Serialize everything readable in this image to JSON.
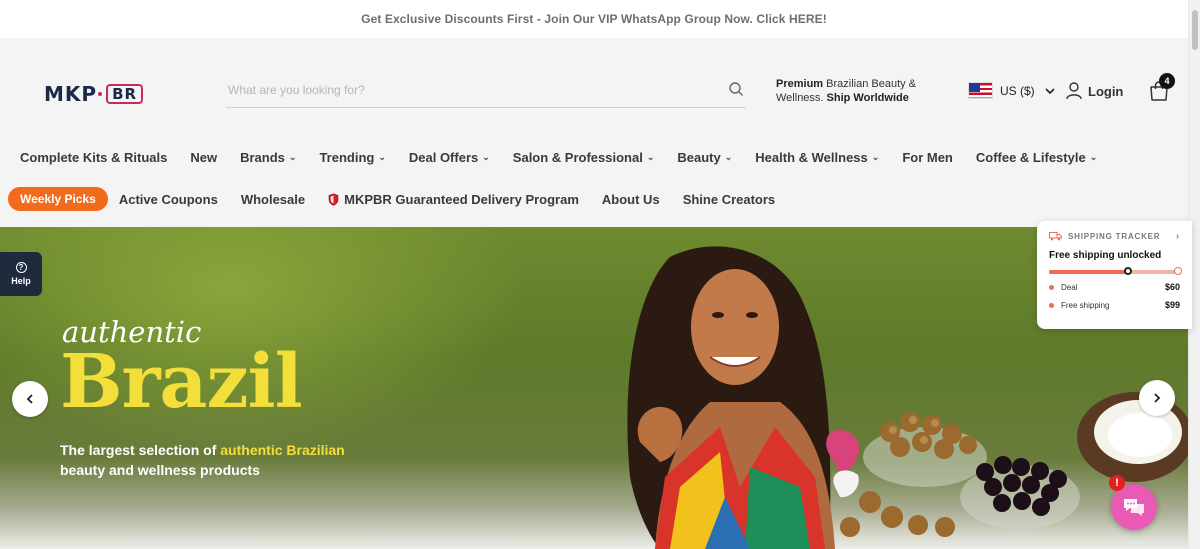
{
  "announcement": {
    "text": "Get Exclusive Discounts First - Join Our VIP WhatsApp Group Now. Click HERE!"
  },
  "header": {
    "logo_main": "MKP",
    "logo_suffix": "BR",
    "search": {
      "placeholder": "What are you looking for?"
    },
    "promo": {
      "bold_1": "Premium",
      "text_1": " Brazilian Beauty & Wellness.",
      "bold_2": " Ship Worldwide"
    },
    "currency": {
      "label": "US ($)"
    },
    "login_label": "Login",
    "cart_count": "4"
  },
  "nav_primary": [
    {
      "label": "Complete Kits & Rituals",
      "dropdown": false
    },
    {
      "label": "New",
      "dropdown": false
    },
    {
      "label": "Brands",
      "dropdown": true
    },
    {
      "label": "Trending",
      "dropdown": true
    },
    {
      "label": "Deal Offers",
      "dropdown": true
    },
    {
      "label": "Salon & Professional",
      "dropdown": true
    },
    {
      "label": "Beauty",
      "dropdown": true
    },
    {
      "label": "Health & Wellness",
      "dropdown": true
    },
    {
      "label": "For Men",
      "dropdown": false
    },
    {
      "label": "Coffee & Lifestyle",
      "dropdown": true
    }
  ],
  "nav_secondary": {
    "highlight": "Weekly Picks",
    "items": [
      "Active Coupons",
      "Wholesale",
      "MKPBR Guaranteed Delivery Program",
      "About Us",
      "Shine Creators"
    ]
  },
  "hero": {
    "kicker": "authentic",
    "headline": "Brazil",
    "subtitle_pre": "The largest selection of ",
    "subtitle_highlight": "authentic Brazilian",
    "subtitle_post": " beauty and wellness products"
  },
  "help": {
    "label": "Help"
  },
  "shipping_tracker": {
    "title": "SHIPPING TRACKER",
    "status": "Free shipping unlocked",
    "progress_fraction": 0.6,
    "rows": [
      {
        "label": "Deal",
        "amount": "$60"
      },
      {
        "label": "Free shipping",
        "amount": "$99"
      }
    ]
  },
  "chat": {
    "notification": "!"
  },
  "colors": {
    "accent_orange": "#f26a1b",
    "hero_yellow": "#f3de3a",
    "chat_pink": "#e85ab3",
    "tracker_coral": "#ef6b55"
  }
}
